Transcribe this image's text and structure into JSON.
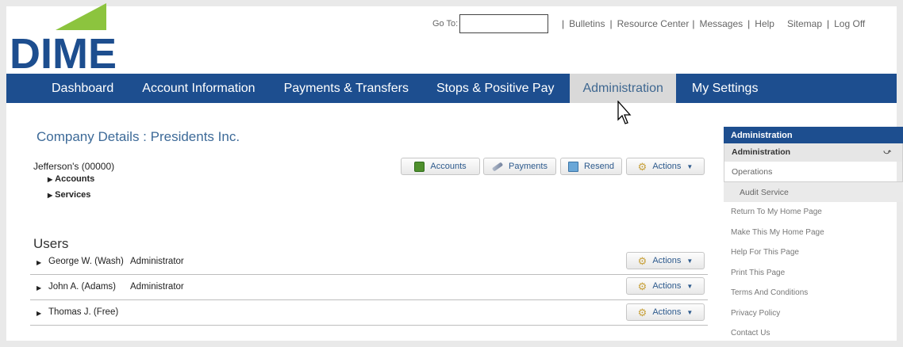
{
  "brand": {
    "logo_text": "DIME",
    "navy": "#1d4e8f",
    "green": "#8cc43e"
  },
  "header": {
    "goto_label": "Go To:",
    "goto_value": "",
    "links": [
      "Bulletins",
      "Resource Center",
      "Messages",
      "Help",
      "Sitemap",
      "Log Off"
    ]
  },
  "nav": {
    "tabs": [
      "Dashboard",
      "Account Information",
      "Payments & Transfers",
      "Stops & Positive Pay",
      "Administration",
      "My Settings"
    ],
    "active": "Administration"
  },
  "company": {
    "title": "Company Details : Presidents Inc.",
    "entity": "Jefferson's (00000)",
    "expanders": [
      "Accounts",
      "Services"
    ],
    "buttons": {
      "accounts": "Accounts",
      "payments": "Payments",
      "resend": "Resend",
      "actions": "Actions"
    }
  },
  "users": {
    "title": "Users",
    "actions_label": "Actions",
    "rows": [
      {
        "name": "George W. (Wash)",
        "role": "Administrator"
      },
      {
        "name": "John A. (Adams)",
        "role": "Administrator"
      },
      {
        "name": "Thomas J. (Free)",
        "role": ""
      }
    ]
  },
  "sidebar": {
    "header": "Administration",
    "selected": "Administration",
    "sub": "Operations",
    "subsub": "Audit Service",
    "links": [
      "Return To My Home Page",
      "Make This My Home Page",
      "Help For This Page",
      "Print This Page",
      "Terms And Conditions",
      "Privacy Policy",
      "Contact Us"
    ]
  }
}
